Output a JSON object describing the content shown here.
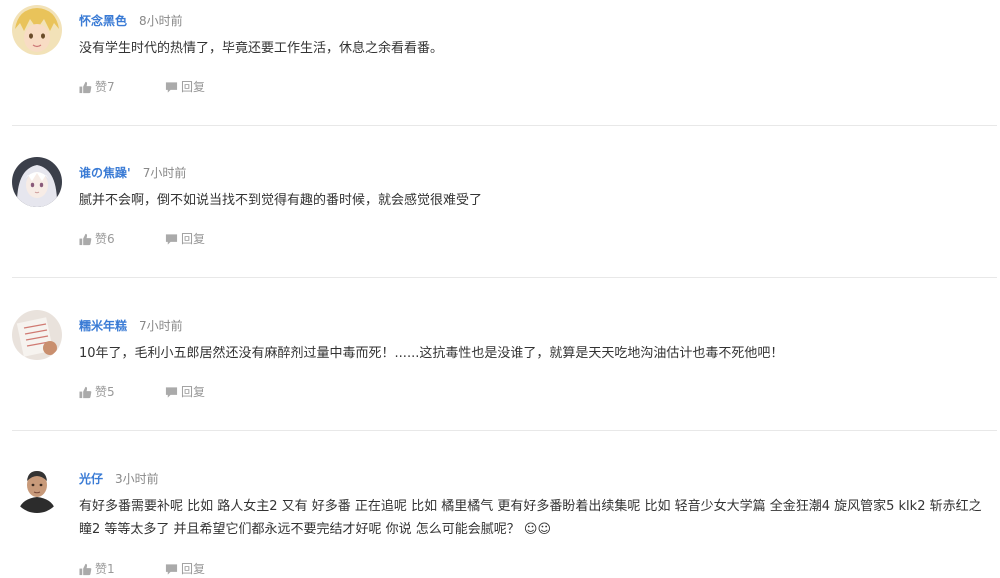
{
  "comments": [
    {
      "username": "怀念黑色",
      "time": "8小时前",
      "text": "没有学生时代的热情了，毕竟还要工作生活，休息之余看看番。",
      "like_label": "赞7",
      "reply_label": "回复"
    },
    {
      "username": "谁の焦躁'",
      "time": "7小时前",
      "text": "腻并不会啊，倒不如说当找不到觉得有趣的番时候，就会感觉很难受了",
      "like_label": "赞6",
      "reply_label": "回复"
    },
    {
      "username": "糯米年糕",
      "time": "7小时前",
      "text": "10年了，毛利小五郎居然还没有麻醉剂过量中毒而死！......这抗毒性也是没谁了，就算是天天吃地沟油估计也毒不死他吧！",
      "like_label": "赞5",
      "reply_label": "回复"
    },
    {
      "username": "光仔",
      "time": "3小时前",
      "text": "有好多番需要补呢 比如 路人女主2 又有 好多番 正在追呢 比如 橘里橘气 更有好多番盼着出续集呢 比如 轻音少女大学篇 全金狂潮4 旋风管家5 klk2 斩赤红之瞳2 等等太多了 并且希望它们都永远不要完结才好呢 你说 怎么可能会腻呢？ ☺☺",
      "like_label": "赞1",
      "reply_label": "回复"
    }
  ],
  "colors": {
    "username": "#3a7bd5",
    "time": "#888888",
    "action": "#999999",
    "divider": "#e8e8e8"
  },
  "icons": {
    "like": "thumbs-up-icon",
    "reply": "speech-bubble-icon"
  }
}
